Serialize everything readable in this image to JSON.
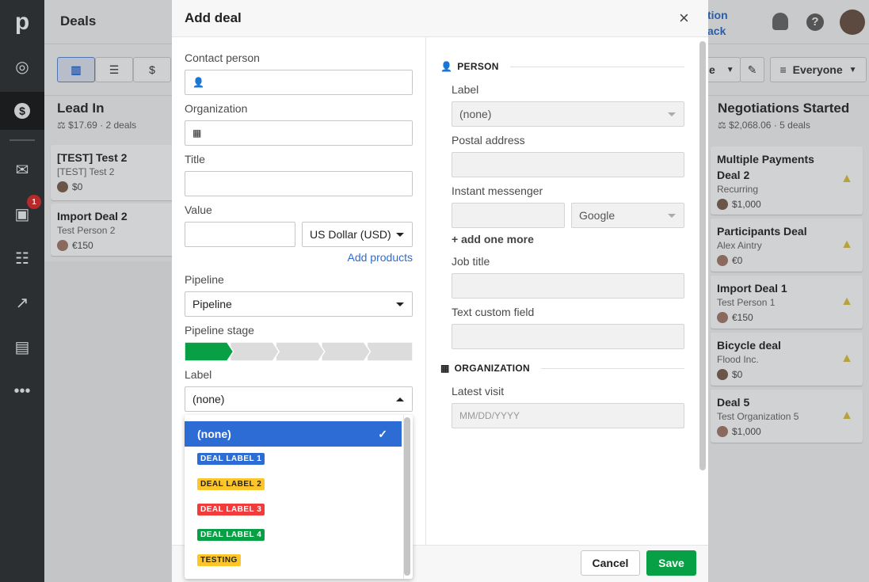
{
  "app": {
    "logo": "p",
    "page_title": "Deals",
    "notification_count": "1",
    "partial_link_1": "tion",
    "partial_link_2": "ack"
  },
  "sidebar": {
    "items": [
      {
        "icon": "target-icon"
      },
      {
        "icon": "dollar-icon",
        "active": true
      },
      {
        "icon": "mail-icon"
      },
      {
        "icon": "calendar-icon"
      },
      {
        "icon": "contacts-icon"
      },
      {
        "icon": "chart-icon"
      },
      {
        "icon": "box-icon"
      },
      {
        "icon": "more-icon",
        "label": "•••"
      }
    ]
  },
  "toolbar": {
    "view_buttons": [
      "pipeline-view",
      "list-view",
      "forecast-view"
    ],
    "partial_dropdown": "e",
    "filter_label": "Everyone"
  },
  "columns": [
    {
      "title": "Lead In",
      "stats": "$17.69 · 2 deals",
      "cards": [
        {
          "title": "[TEST] Test 2",
          "subtitle": "[TEST] Test 2",
          "value": "$0"
        },
        {
          "title": "Import Deal 2",
          "subtitle": "Test Person 2",
          "value": "€150"
        }
      ]
    },
    {
      "title": "Negotiations Started",
      "stats": "$2,068.06 · 5 deals",
      "cards": [
        {
          "title": "Multiple Payments Deal 2",
          "subtitle": "Recurring",
          "value": "$1,000"
        },
        {
          "title": "Participants Deal",
          "subtitle": "Alex Aintry",
          "value": "€0"
        },
        {
          "title": "Import Deal 1",
          "subtitle": "Test Person 1",
          "value": "€150"
        },
        {
          "title": "Bicycle deal",
          "subtitle": "Flood Inc.",
          "value": "$0"
        },
        {
          "title": "Deal 5",
          "subtitle": "Test Organization 5",
          "value": "$1,000"
        }
      ]
    }
  ],
  "modal": {
    "title": "Add deal",
    "left": {
      "contact_label": "Contact person",
      "contact_value": "",
      "organization_label": "Organization",
      "organization_value": "",
      "title_label": "Title",
      "title_value": "",
      "value_label": "Value",
      "value_value": "",
      "currency": "US Dollar (USD)",
      "add_products": "Add products",
      "pipeline_label": "Pipeline",
      "pipeline_value": "Pipeline",
      "stage_label": "Pipeline stage",
      "stage_count": 5,
      "stage_selected": 1,
      "label_label": "Label",
      "label_value": "(none)"
    },
    "label_dropdown": {
      "options": [
        {
          "text": "(none)",
          "selected": true
        },
        {
          "text": "DEAL LABEL 1",
          "bg": "#2d6cd5",
          "fg": "#ffffff"
        },
        {
          "text": "DEAL LABEL 2",
          "bg": "#fcc62b",
          "fg": "#222222"
        },
        {
          "text": "DEAL LABEL 3",
          "bg": "#f23b3b",
          "fg": "#ffffff"
        },
        {
          "text": "DEAL LABEL 4",
          "bg": "#08a045",
          "fg": "#ffffff"
        },
        {
          "text": "TESTING",
          "bg": "#fcc62b",
          "fg": "#222222"
        }
      ]
    },
    "person": {
      "section": "PERSON",
      "label_label": "Label",
      "label_value": "(none)",
      "postal_label": "Postal address",
      "im_label": "Instant messenger",
      "im_type": "Google",
      "add_more": "+ add one more",
      "job_label": "Job title",
      "custom_label": "Text custom field"
    },
    "organization": {
      "section": "ORGANIZATION",
      "visit_label": "Latest visit",
      "visit_placeholder": "MM/DD/YYYY"
    },
    "cancel": "Cancel",
    "save": "Save"
  },
  "colors": {
    "accent": "#2d6cd5",
    "save": "#08a045",
    "stage_active": "#08a045"
  }
}
